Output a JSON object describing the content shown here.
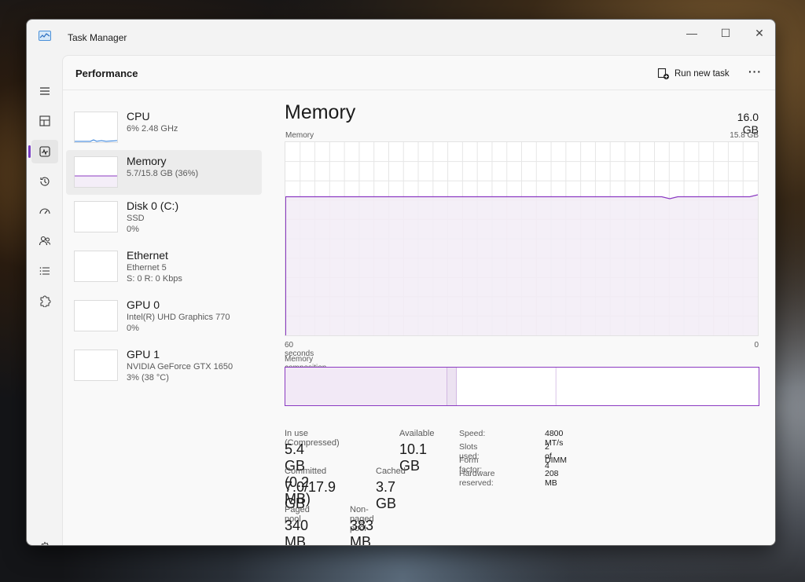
{
  "window": {
    "title": "Task Manager",
    "minimize": "—",
    "maximize": "☐",
    "close": "✕"
  },
  "nav": {
    "items": [
      "menu-icon",
      "processes-icon",
      "performance-icon",
      "app-history-icon",
      "startup-apps-icon",
      "users-icon",
      "details-icon",
      "services-icon",
      "settings-icon"
    ],
    "active": "performance-icon"
  },
  "header": {
    "title": "Performance",
    "run_new_task": "Run new task",
    "more": "···"
  },
  "devices": [
    {
      "name": "CPU",
      "line1": "6% 2.48 GHz",
      "line2": ""
    },
    {
      "name": "Memory",
      "line1": "5.7/15.8 GB (36%)",
      "line2": ""
    },
    {
      "name": "Disk 0 (C:)",
      "line1": "SSD",
      "line2": "0%"
    },
    {
      "name": "Ethernet",
      "line1": "Ethernet 5",
      "line2": "S: 0 R: 0 Kbps"
    },
    {
      "name": "GPU 0",
      "line1": "Intel(R) UHD Graphics 770",
      "line2": "0%"
    },
    {
      "name": "GPU 1",
      "line1": "NVIDIA GeForce GTX 1650",
      "line2": "3% (38 °C)"
    }
  ],
  "detail": {
    "title": "Memory",
    "total": "16.0 GB",
    "usage_label": "Memory usage",
    "usage_max": "15.8 GB",
    "axis_left": "60 seconds",
    "axis_right": "0",
    "composition_label": "Memory composition",
    "stats": {
      "in_use_label": "In use (Compressed)",
      "in_use": "5.4 GB (0.2 MB)",
      "available_label": "Available",
      "available": "10.1 GB",
      "committed_label": "Committed",
      "committed": "7.0/17.9 GB",
      "cached_label": "Cached",
      "cached": "3.7 GB",
      "paged_label": "Paged pool",
      "paged": "340 MB",
      "nonpaged_label": "Non-paged pool",
      "nonpaged": "383 MB"
    },
    "specs": [
      {
        "key": "Speed:",
        "value": "4800 MT/s"
      },
      {
        "key": "Slots used:",
        "value": "2 of 4"
      },
      {
        "key": "Form factor:",
        "value": "DIMM"
      },
      {
        "key": "Hardware reserved:",
        "value": "208 MB"
      }
    ]
  },
  "chart_data": {
    "type": "area",
    "series": [
      {
        "values": [
          35,
          35,
          35,
          35,
          35,
          35,
          35,
          35,
          35,
          35,
          35,
          35,
          35,
          35,
          35,
          35,
          35,
          35,
          35,
          35,
          35,
          35,
          35,
          35,
          35,
          35,
          35,
          35,
          35,
          35,
          35,
          35,
          35,
          35,
          35,
          35,
          35,
          35,
          35,
          35,
          35,
          35,
          35,
          35,
          35,
          35,
          35,
          35,
          34.5,
          35,
          35,
          35,
          35,
          35,
          35,
          35,
          35,
          35,
          35,
          35.5
        ]
      }
    ],
    "ylim": [
      0,
      15.8
    ],
    "xlim": [
      60,
      0
    ],
    "colors": {
      "line": "#8b3ac2",
      "fill": "#f2ecf6",
      "grid": "#e6e6e6"
    }
  },
  "composition": {
    "in_use_fraction": 0.342,
    "modified_fraction": 0.02,
    "standby_fraction": 0.21,
    "free_fraction": 0.428
  }
}
